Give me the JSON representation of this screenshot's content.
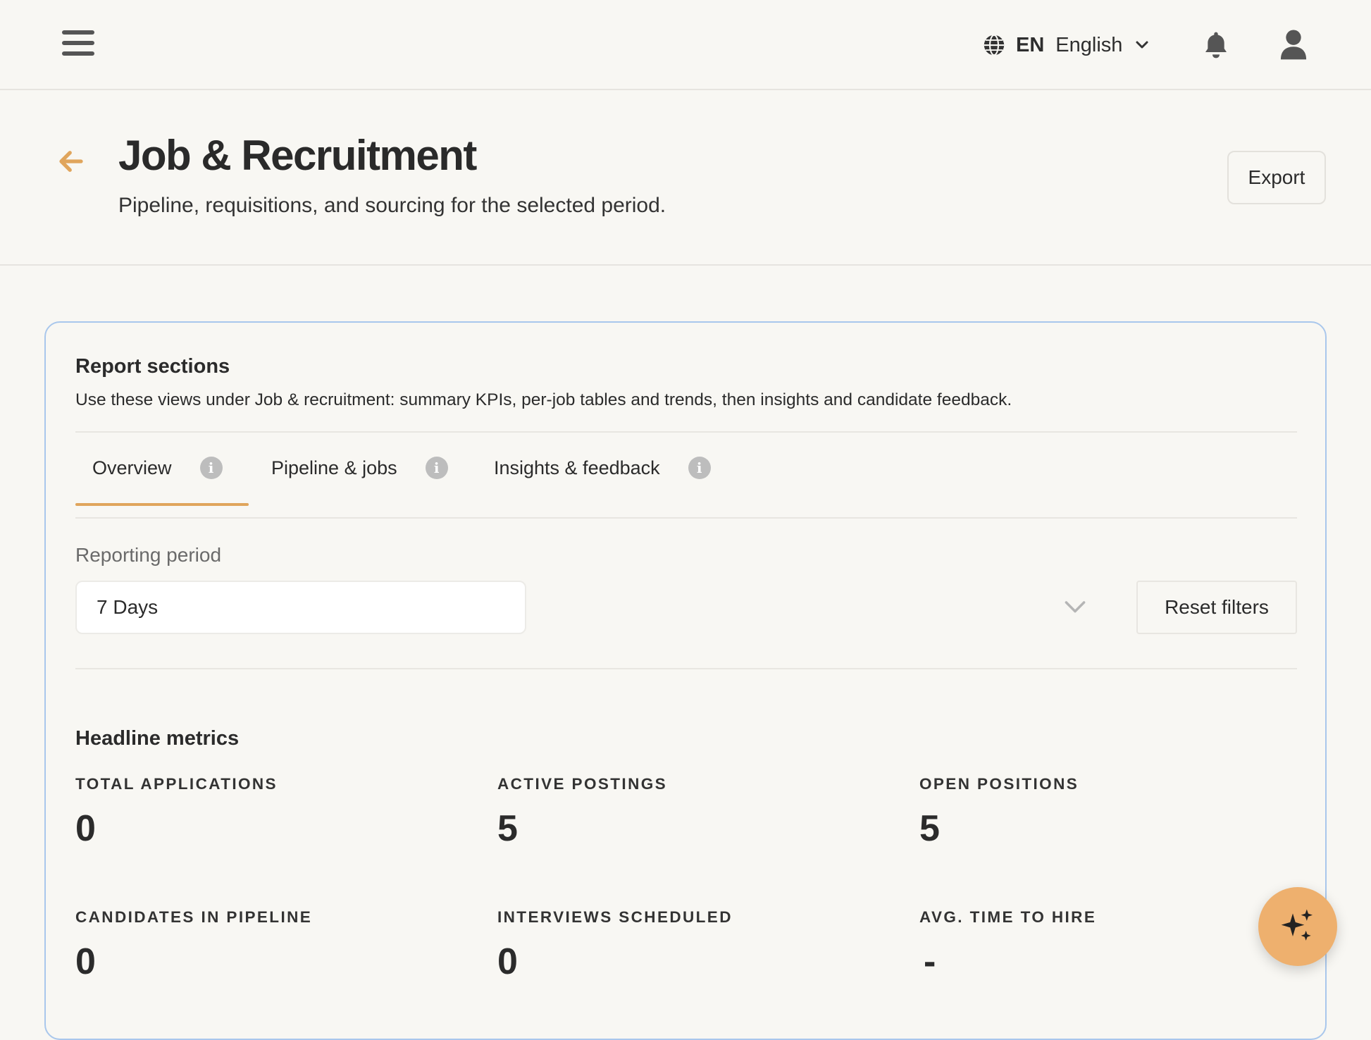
{
  "topbar": {
    "menu_icon": "hamburger-icon",
    "language_code": "EN",
    "language_name": "English",
    "notification_icon": "bell-icon",
    "profile_icon": "user-icon"
  },
  "header": {
    "title": "Job & Recruitment",
    "subtitle": "Pipeline, requisitions, and sourcing for the selected period.",
    "export_label": "Export",
    "back_icon": "arrow-left-icon"
  },
  "report_sections": {
    "title": "Report sections",
    "description": "Use these views under Job & recruitment: summary KPIs, per-job tables and trends, then insights and candidate feedback.",
    "tabs": [
      {
        "label": "Overview",
        "active": true
      },
      {
        "label": "Pipeline & jobs",
        "active": false
      },
      {
        "label": "Insights & feedback",
        "active": false
      }
    ],
    "info_glyph": "i"
  },
  "filters": {
    "period_label": "Reporting period",
    "period_value": "7 Days",
    "reset_label": "Reset filters"
  },
  "metrics": {
    "title": "Headline metrics",
    "items": [
      {
        "label": "TOTAL APPLICATIONS",
        "value": "0"
      },
      {
        "label": "ACTIVE POSTINGS",
        "value": "5"
      },
      {
        "label": "OPEN POSITIONS",
        "value": "5"
      },
      {
        "label": "CANDIDATES IN PIPELINE",
        "value": "0"
      },
      {
        "label": "INTERVIEWS SCHEDULED",
        "value": "0"
      },
      {
        "label": "AVG. TIME TO HIRE",
        "value": "-"
      }
    ]
  },
  "colors": {
    "accent": "#e0a55c",
    "fab": "#eeb06e",
    "card_border": "#a9c7ec",
    "background": "#f8f7f3"
  }
}
